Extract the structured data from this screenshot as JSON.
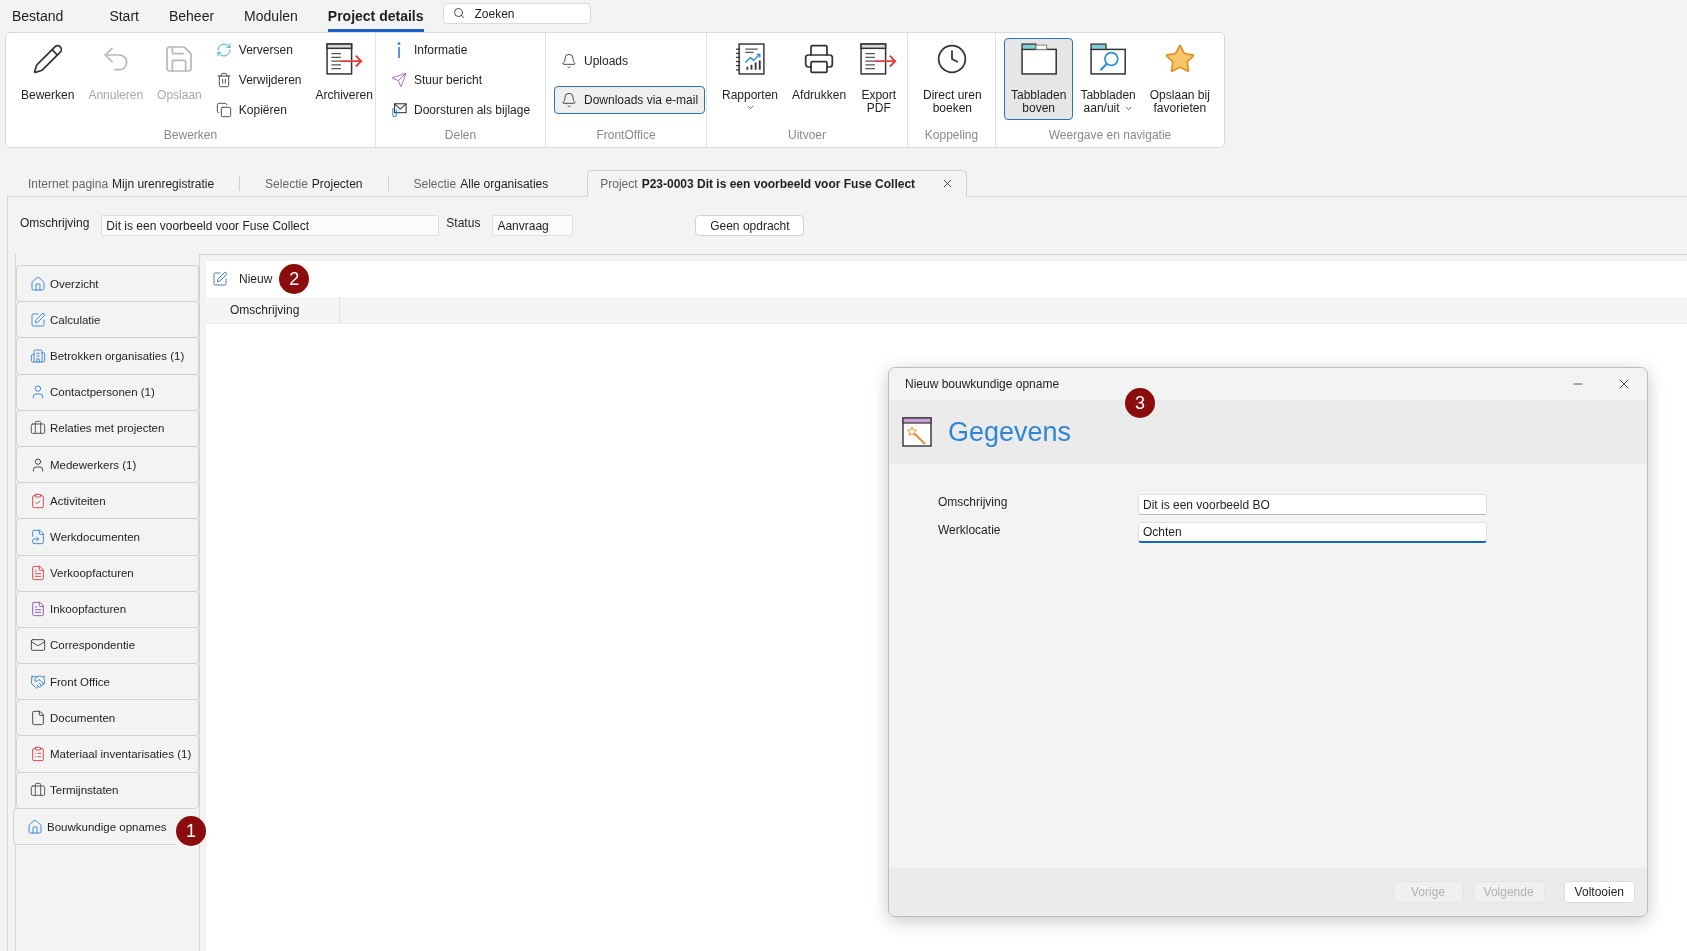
{
  "menu": {
    "items": [
      {
        "label": "Bestand",
        "selected": false
      },
      {
        "label": "Start",
        "selected": false
      },
      {
        "label": "Beheer",
        "selected": false
      },
      {
        "label": "Modulen",
        "selected": false
      },
      {
        "label": "Project details",
        "selected": true
      }
    ],
    "search": {
      "placeholder": "Zoeken"
    }
  },
  "ribbon": {
    "groups": [
      {
        "label": "Bewerken",
        "items": [
          {
            "kind": "large",
            "label": "Bewerken",
            "disabled": false,
            "selected": false,
            "dropdown": false
          },
          {
            "kind": "large",
            "label": "Annuleren",
            "disabled": true,
            "selected": false,
            "dropdown": false
          },
          {
            "kind": "large",
            "label": "Opslaan",
            "disabled": true,
            "selected": false,
            "dropdown": false
          },
          {
            "kind": "stack",
            "items": [
              {
                "label": "Verversen",
                "selected": false
              },
              {
                "label": "Verwijderen",
                "selected": false
              },
              {
                "label": "Kopiëren",
                "selected": false
              }
            ]
          },
          {
            "kind": "large",
            "label": "Archiveren",
            "disabled": false,
            "selected": false,
            "dropdown": false
          }
        ]
      },
      {
        "label": "Delen",
        "items": [
          {
            "kind": "stack",
            "items": [
              {
                "label": "Informatie",
                "selected": false
              },
              {
                "label": "Stuur bericht",
                "selected": false
              },
              {
                "label": "Doorsturen als bijlage",
                "selected": false
              }
            ]
          }
        ]
      },
      {
        "label": "FrontOffice",
        "items": [
          {
            "kind": "stack",
            "items": [
              {
                "label": "Uploads",
                "selected": false
              },
              {
                "label": "Downloads via e-mail",
                "selected": true
              }
            ]
          }
        ]
      },
      {
        "label": "Uitvoer",
        "items": [
          {
            "kind": "large",
            "label": "Rapporten",
            "disabled": false,
            "selected": false,
            "dropdown": true
          },
          {
            "kind": "large",
            "label": "Afdrukken",
            "disabled": false,
            "selected": false,
            "dropdown": false
          },
          {
            "kind": "large",
            "label": "Export PDF",
            "disabled": false,
            "selected": false,
            "dropdown": false
          }
        ]
      },
      {
        "label": "Koppeling",
        "items": [
          {
            "kind": "large",
            "label": "Direct uren boeken",
            "disabled": false,
            "selected": false,
            "dropdown": false
          }
        ]
      },
      {
        "label": "Weergave en navigatie",
        "items": [
          {
            "kind": "large",
            "label": "Tabbladen boven",
            "disabled": false,
            "selected": true,
            "dropdown": false
          },
          {
            "kind": "large",
            "label": "Tabbladen aan/uit",
            "disabled": false,
            "selected": false,
            "dropdown": true
          },
          {
            "kind": "large",
            "label": "Opslaan bij favorieten",
            "disabled": false,
            "selected": false,
            "dropdown": false
          }
        ]
      }
    ]
  },
  "document_tabs": [
    {
      "prefix": "Internet pagina",
      "title": "Mijn urenregistratie",
      "selected": false,
      "closable": false
    },
    {
      "prefix": "Selectie",
      "title": "Projecten",
      "selected": false,
      "closable": false
    },
    {
      "prefix": "Selectie",
      "title": "Alle organisaties",
      "selected": false,
      "closable": false
    },
    {
      "prefix": "Project",
      "title": "P23-0003 Dit is een voorbeeld voor Fuse Collect",
      "selected": true,
      "closable": true
    }
  ],
  "header_form": {
    "fields": [
      {
        "label": "Omschrijving",
        "value": "Dit is een voorbeeld voor Fuse Collect"
      },
      {
        "label": "Status",
        "value": "Aanvraag"
      }
    ],
    "button": "Geen opdracht"
  },
  "sidebar": {
    "items": [
      {
        "label": "Overzicht",
        "selected": false
      },
      {
        "label": "Calculatie",
        "selected": false
      },
      {
        "label": "Betrokken organisaties (1)",
        "selected": false
      },
      {
        "label": "Contactpersonen (1)",
        "selected": false
      },
      {
        "label": "Relaties met projecten",
        "selected": false
      },
      {
        "label": "Medewerkers (1)",
        "selected": false
      },
      {
        "label": "Activiteiten",
        "selected": false
      },
      {
        "label": "Werkdocumenten",
        "selected": false
      },
      {
        "label": "Verkoopfacturen",
        "selected": false
      },
      {
        "label": "Inkoopfacturen",
        "selected": false
      },
      {
        "label": "Correspondentie",
        "selected": false
      },
      {
        "label": "Front Office",
        "selected": false
      },
      {
        "label": "Documenten",
        "selected": false
      },
      {
        "label": "Materiaal inventarisaties (1)",
        "selected": false
      },
      {
        "label": "Termijnstaten",
        "selected": false
      },
      {
        "label": "Bouwkundige opnames",
        "selected": true
      }
    ],
    "callout": "1"
  },
  "content": {
    "toolbar": {
      "button": "Nieuw",
      "callout": "2"
    },
    "table": {
      "columns": [
        "Omschrijving"
      ]
    }
  },
  "dialog": {
    "title": "Nieuw bouwkundige opname",
    "heading": "Gegevens",
    "callout": "3",
    "fields": [
      {
        "label": "Omschrijving",
        "value": "Dit is een voorbeeld BO",
        "focused": false
      },
      {
        "label": "Werklocatie",
        "value": "Ochten",
        "focused": true
      }
    ],
    "buttons": [
      {
        "label": "Vorige",
        "disabled": true
      },
      {
        "label": "Volgende",
        "disabled": true
      },
      {
        "label": "Voltooien",
        "disabled": false
      }
    ]
  }
}
